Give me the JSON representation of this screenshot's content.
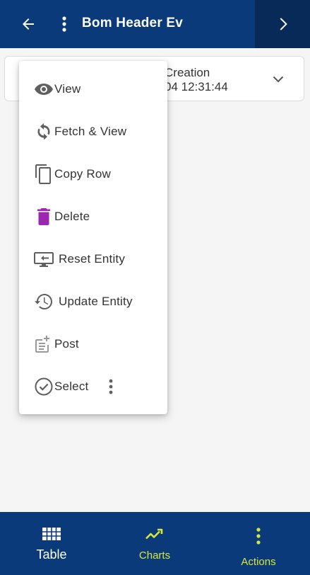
{
  "header": {
    "title": "Bom Header Ev"
  },
  "record_card": {
    "line1": "Creation",
    "line2": "04 12:31:44"
  },
  "context_menu": {
    "items": [
      {
        "label": "View",
        "icon": "eye-icon"
      },
      {
        "label": "Fetch & View",
        "icon": "refresh-icon"
      },
      {
        "label": "Copy Row",
        "icon": "copy-icon"
      },
      {
        "label": "Delete",
        "icon": "trash-icon"
      },
      {
        "label": "Reset Entity",
        "icon": "reset-icon"
      },
      {
        "label": "Update Entity",
        "icon": "history-icon"
      },
      {
        "label": "Post",
        "icon": "post-icon"
      },
      {
        "label": "Select",
        "icon": "check-circle-icon"
      }
    ]
  },
  "bottom_nav": {
    "tabs": [
      {
        "label": "Table",
        "icon": "grid-icon"
      },
      {
        "label": "Charts",
        "icon": "trend-icon"
      },
      {
        "label": "Actions",
        "icon": "more-vertical-icon"
      }
    ]
  },
  "colors": {
    "header_bg": "#0b3a7a",
    "next_button_bg": "#072a58",
    "accent_yellow": "#d6e83a",
    "delete_purple": "#9c27b0"
  }
}
